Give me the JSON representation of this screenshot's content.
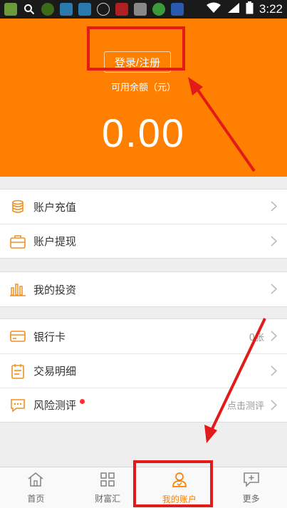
{
  "statusbar": {
    "time": "3:22",
    "app_icons": [
      "app-icon-1",
      "search-icon",
      "app-icon-3",
      "app-icon-4",
      "app-icon-5",
      "app-icon-6",
      "app-icon-7",
      "app-icon-8",
      "app-icon-9",
      "app-icon-10"
    ],
    "right_icons": [
      "wifi-icon",
      "signal-icon",
      "battery-icon"
    ]
  },
  "header": {
    "login_label": "登录/注册",
    "balance_label": "可用余额（元）",
    "balance_value": "0.00",
    "background_color": "#ff7f00"
  },
  "menu": {
    "group1": [
      {
        "icon": "coin-stack-icon",
        "label": "账户充值"
      },
      {
        "icon": "briefcase-icon",
        "label": "账户提现"
      }
    ],
    "group2": [
      {
        "icon": "bar-chart-icon",
        "label": "我的投资"
      }
    ],
    "group3": [
      {
        "icon": "credit-card-icon",
        "label": "银行卡",
        "value": "0张"
      },
      {
        "icon": "calendar-icon",
        "label": "交易明细"
      },
      {
        "icon": "chat-icon",
        "label": "风险测评",
        "value": "点击测评"
      }
    ]
  },
  "tabbar": {
    "tabs": [
      {
        "icon": "home-icon",
        "label": "首页",
        "active": false
      },
      {
        "icon": "grid-icon",
        "label": "财富汇",
        "active": false
      },
      {
        "icon": "user-icon",
        "label": "我的账户",
        "active": true
      },
      {
        "icon": "chat-plus-icon",
        "label": "更多",
        "active": false
      }
    ]
  },
  "colors": {
    "accent": "#ff7f00",
    "annotation": "#e21a1a"
  }
}
